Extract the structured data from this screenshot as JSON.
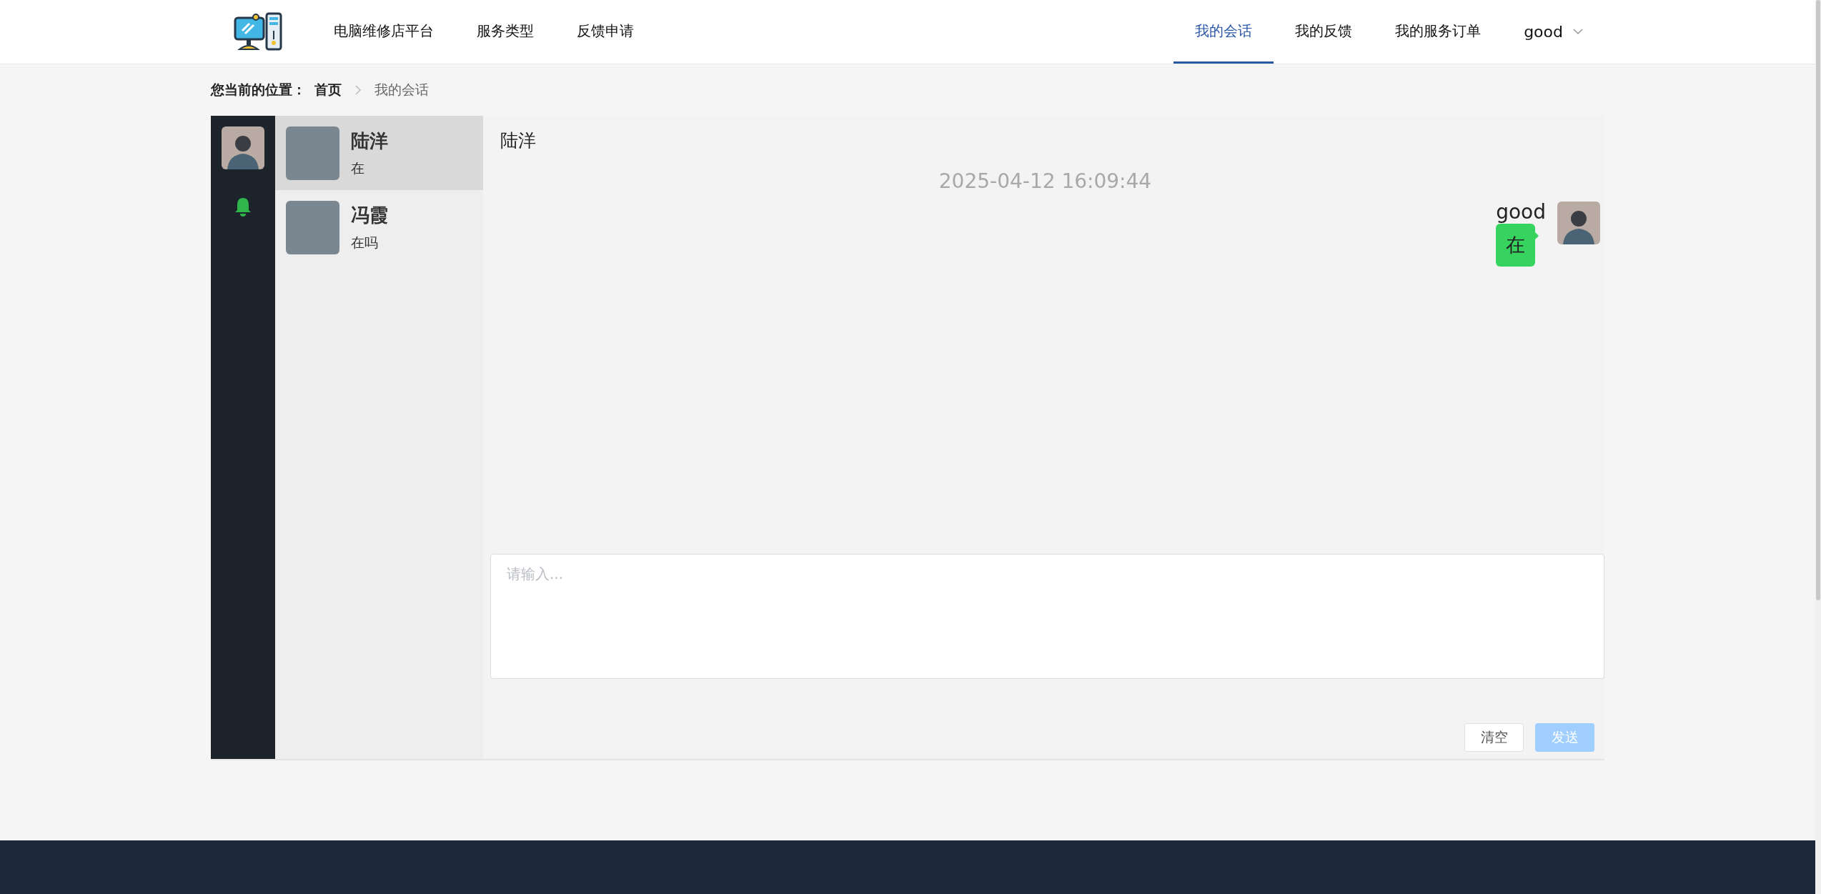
{
  "header": {
    "nav_left": [
      "电脑维修店平台",
      "服务类型",
      "反馈申请"
    ],
    "nav_right": [
      {
        "label": "我的会话",
        "selected": true
      },
      {
        "label": "我的反馈",
        "selected": false
      },
      {
        "label": "我的服务订单",
        "selected": false
      }
    ],
    "user": "good"
  },
  "breadcrumb": {
    "label": "您当前的位置：",
    "items": [
      "首页",
      "我的会话"
    ]
  },
  "contacts": [
    {
      "name": "陆洋",
      "last_message": "在",
      "selected": true
    },
    {
      "name": "冯霞",
      "last_message": "在吗",
      "selected": false
    }
  ],
  "chat": {
    "title": "陆洋",
    "messages": [
      {
        "time": "2025-04-12 16:09:44",
        "sender": "good",
        "text": "在",
        "mine": true
      }
    ]
  },
  "composer": {
    "placeholder": "请输入...",
    "buttons": [
      {
        "label": "清空",
        "kind": "default",
        "disabled": false
      },
      {
        "label": "发送",
        "kind": "primary",
        "disabled": true
      }
    ]
  }
}
